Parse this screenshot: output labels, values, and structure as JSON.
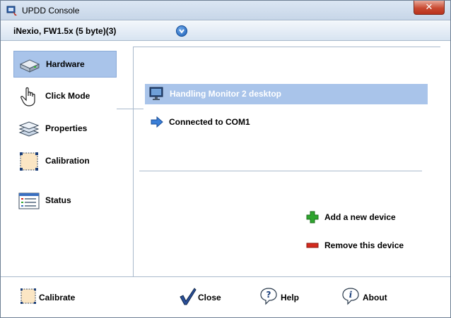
{
  "window": {
    "title": "UPDD Console",
    "close_glyph": "✕"
  },
  "device_bar": {
    "device_name": "iNexio, FW1.5x (5 byte)(3)",
    "dropdown_icon": "chevron-down-circle-icon"
  },
  "nav": {
    "items": [
      {
        "label": "Hardware",
        "icon": "hardware-icon",
        "selected": true
      },
      {
        "label": "Click Mode",
        "icon": "hand-pointer-icon",
        "selected": false
      },
      {
        "label": "Properties",
        "icon": "layers-icon",
        "selected": false
      },
      {
        "label": "Calibration",
        "icon": "calibration-icon",
        "selected": false
      },
      {
        "label": "Status",
        "icon": "status-list-icon",
        "selected": false
      }
    ]
  },
  "content": {
    "monitor": "Handling Monitor 2 desktop",
    "connection": "Connected to COM1",
    "add_device": "Add a new device",
    "remove_device": "Remove this device"
  },
  "footer": {
    "calibrate": "Calibrate",
    "close": "Close",
    "help": "Help",
    "about": "About"
  },
  "colors": {
    "selection": "#a9c4ea",
    "border": "#a9b9cc",
    "accent_blue": "#1b5fb8",
    "add_green": "#2fa52f",
    "remove_red": "#d42a1e"
  }
}
